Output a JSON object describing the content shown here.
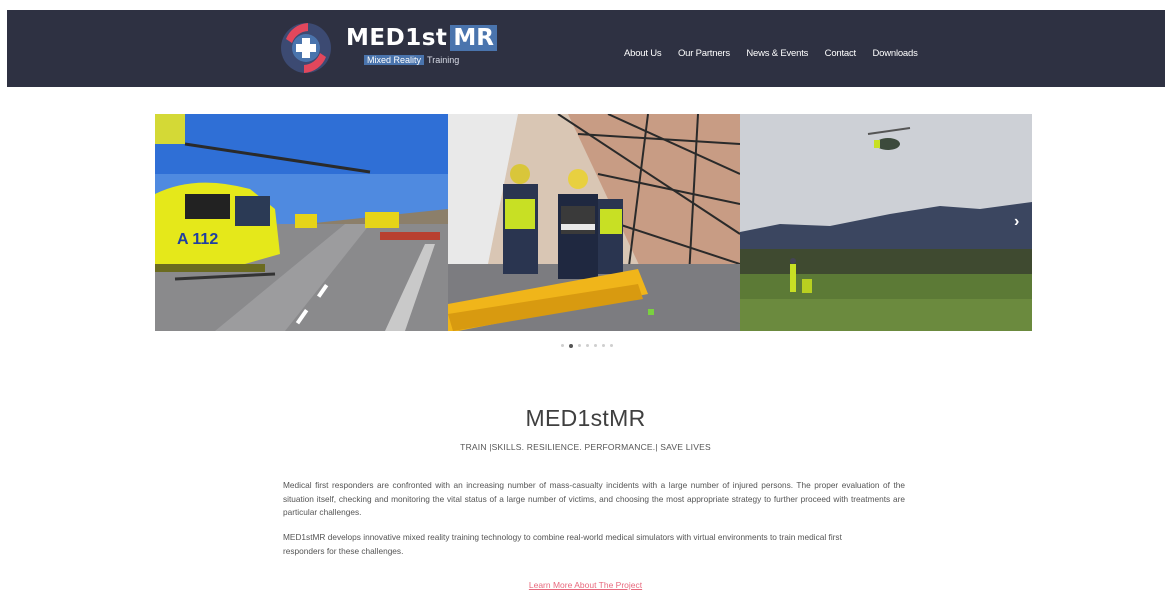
{
  "logo": {
    "title_main": "MED1st",
    "title_box": "MR",
    "subtitle_box": "Mixed Reality",
    "subtitle_rest": "Training"
  },
  "nav": {
    "items": [
      "About Us",
      "Our Partners",
      "News & Events",
      "Contact",
      "Downloads"
    ]
  },
  "slider": {
    "images": [
      {
        "label": "helicopter-on-road",
        "icon": "image"
      },
      {
        "label": "responders-in-tent",
        "icon": "image"
      },
      {
        "label": "helicopter-over-field",
        "icon": "image"
      }
    ],
    "prev_icon": "chevron-left-icon",
    "next_icon": "chevron-right-icon",
    "next_glyph": "›",
    "dot_count": 7,
    "active_dot_index": 1
  },
  "intro": {
    "title": "MED1stMR",
    "tagline": "TRAIN |SKILLS. RESILIENCE. PERFORMANCE.| SAVE LIVES",
    "paragraph1": "Medical first responders are confronted with an increasing number of mass-casualty incidents with a large number of injured persons. The proper evaluation of the situation itself, checking and monitoring the vital status of a large number of victims, and choosing the most appropriate strategy to further proceed with treatments are particular challenges.",
    "paragraph2": "MED1stMR develops innovative mixed reality training technology to combine real-world medical simulators with virtual environments to train medical first responders for these challenges.",
    "learn_more": "Learn More About The Project"
  },
  "colors": {
    "header_bg": "#2e3142",
    "accent_blue": "#4a74ad",
    "link_pink": "#e86a7e"
  }
}
